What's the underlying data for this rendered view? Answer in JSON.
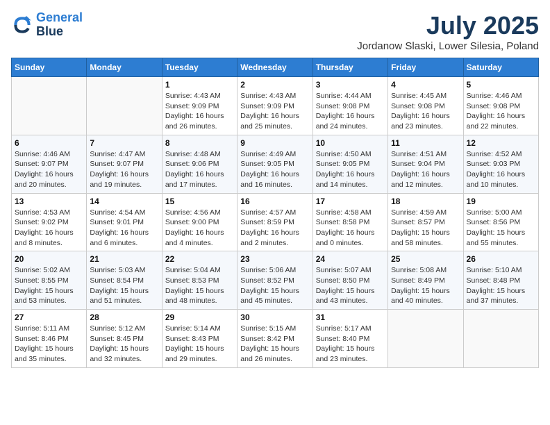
{
  "header": {
    "logo_line1": "General",
    "logo_line2": "Blue",
    "month": "July 2025",
    "location": "Jordanow Slaski, Lower Silesia, Poland"
  },
  "weekdays": [
    "Sunday",
    "Monday",
    "Tuesday",
    "Wednesday",
    "Thursday",
    "Friday",
    "Saturday"
  ],
  "weeks": [
    [
      {
        "day": "",
        "info": ""
      },
      {
        "day": "",
        "info": ""
      },
      {
        "day": "1",
        "info": "Sunrise: 4:43 AM\nSunset: 9:09 PM\nDaylight: 16 hours\nand 26 minutes."
      },
      {
        "day": "2",
        "info": "Sunrise: 4:43 AM\nSunset: 9:09 PM\nDaylight: 16 hours\nand 25 minutes."
      },
      {
        "day": "3",
        "info": "Sunrise: 4:44 AM\nSunset: 9:08 PM\nDaylight: 16 hours\nand 24 minutes."
      },
      {
        "day": "4",
        "info": "Sunrise: 4:45 AM\nSunset: 9:08 PM\nDaylight: 16 hours\nand 23 minutes."
      },
      {
        "day": "5",
        "info": "Sunrise: 4:46 AM\nSunset: 9:08 PM\nDaylight: 16 hours\nand 22 minutes."
      }
    ],
    [
      {
        "day": "6",
        "info": "Sunrise: 4:46 AM\nSunset: 9:07 PM\nDaylight: 16 hours\nand 20 minutes."
      },
      {
        "day": "7",
        "info": "Sunrise: 4:47 AM\nSunset: 9:07 PM\nDaylight: 16 hours\nand 19 minutes."
      },
      {
        "day": "8",
        "info": "Sunrise: 4:48 AM\nSunset: 9:06 PM\nDaylight: 16 hours\nand 17 minutes."
      },
      {
        "day": "9",
        "info": "Sunrise: 4:49 AM\nSunset: 9:05 PM\nDaylight: 16 hours\nand 16 minutes."
      },
      {
        "day": "10",
        "info": "Sunrise: 4:50 AM\nSunset: 9:05 PM\nDaylight: 16 hours\nand 14 minutes."
      },
      {
        "day": "11",
        "info": "Sunrise: 4:51 AM\nSunset: 9:04 PM\nDaylight: 16 hours\nand 12 minutes."
      },
      {
        "day": "12",
        "info": "Sunrise: 4:52 AM\nSunset: 9:03 PM\nDaylight: 16 hours\nand 10 minutes."
      }
    ],
    [
      {
        "day": "13",
        "info": "Sunrise: 4:53 AM\nSunset: 9:02 PM\nDaylight: 16 hours\nand 8 minutes."
      },
      {
        "day": "14",
        "info": "Sunrise: 4:54 AM\nSunset: 9:01 PM\nDaylight: 16 hours\nand 6 minutes."
      },
      {
        "day": "15",
        "info": "Sunrise: 4:56 AM\nSunset: 9:00 PM\nDaylight: 16 hours\nand 4 minutes."
      },
      {
        "day": "16",
        "info": "Sunrise: 4:57 AM\nSunset: 8:59 PM\nDaylight: 16 hours\nand 2 minutes."
      },
      {
        "day": "17",
        "info": "Sunrise: 4:58 AM\nSunset: 8:58 PM\nDaylight: 16 hours\nand 0 minutes."
      },
      {
        "day": "18",
        "info": "Sunrise: 4:59 AM\nSunset: 8:57 PM\nDaylight: 15 hours\nand 58 minutes."
      },
      {
        "day": "19",
        "info": "Sunrise: 5:00 AM\nSunset: 8:56 PM\nDaylight: 15 hours\nand 55 minutes."
      }
    ],
    [
      {
        "day": "20",
        "info": "Sunrise: 5:02 AM\nSunset: 8:55 PM\nDaylight: 15 hours\nand 53 minutes."
      },
      {
        "day": "21",
        "info": "Sunrise: 5:03 AM\nSunset: 8:54 PM\nDaylight: 15 hours\nand 51 minutes."
      },
      {
        "day": "22",
        "info": "Sunrise: 5:04 AM\nSunset: 8:53 PM\nDaylight: 15 hours\nand 48 minutes."
      },
      {
        "day": "23",
        "info": "Sunrise: 5:06 AM\nSunset: 8:52 PM\nDaylight: 15 hours\nand 45 minutes."
      },
      {
        "day": "24",
        "info": "Sunrise: 5:07 AM\nSunset: 8:50 PM\nDaylight: 15 hours\nand 43 minutes."
      },
      {
        "day": "25",
        "info": "Sunrise: 5:08 AM\nSunset: 8:49 PM\nDaylight: 15 hours\nand 40 minutes."
      },
      {
        "day": "26",
        "info": "Sunrise: 5:10 AM\nSunset: 8:48 PM\nDaylight: 15 hours\nand 37 minutes."
      }
    ],
    [
      {
        "day": "27",
        "info": "Sunrise: 5:11 AM\nSunset: 8:46 PM\nDaylight: 15 hours\nand 35 minutes."
      },
      {
        "day": "28",
        "info": "Sunrise: 5:12 AM\nSunset: 8:45 PM\nDaylight: 15 hours\nand 32 minutes."
      },
      {
        "day": "29",
        "info": "Sunrise: 5:14 AM\nSunset: 8:43 PM\nDaylight: 15 hours\nand 29 minutes."
      },
      {
        "day": "30",
        "info": "Sunrise: 5:15 AM\nSunset: 8:42 PM\nDaylight: 15 hours\nand 26 minutes."
      },
      {
        "day": "31",
        "info": "Sunrise: 5:17 AM\nSunset: 8:40 PM\nDaylight: 15 hours\nand 23 minutes."
      },
      {
        "day": "",
        "info": ""
      },
      {
        "day": "",
        "info": ""
      }
    ]
  ]
}
